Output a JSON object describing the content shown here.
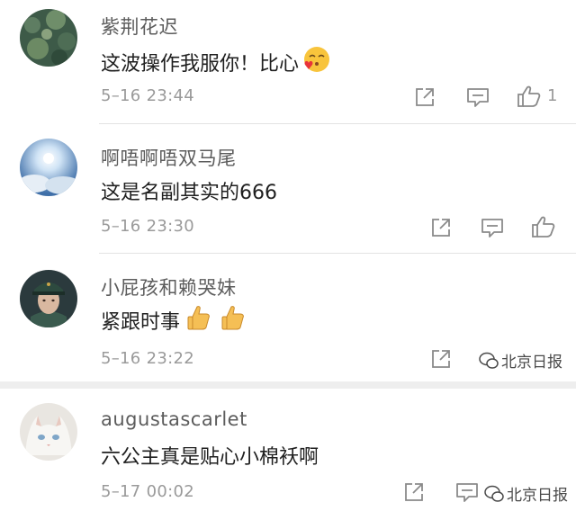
{
  "comments": [
    {
      "username": "紫荆花迟",
      "text": "这波操作我服你！比心",
      "time": "5–16 23:44",
      "likes": "1",
      "emoji": "kiss-heart-emoji-icon"
    },
    {
      "username": "啊唔啊唔双马尾",
      "text": "这是名副其实的666",
      "time": "5–16 23:30"
    },
    {
      "username": "小屁孩和赖哭妹",
      "text": "紧跟时事",
      "time": "5–16 23:22",
      "emoji": "thumbs-up-emoji-icon"
    },
    {
      "username": "augustascarlet",
      "text": "六公主真是贴心小棉袄啊",
      "time": "5–17 00:02"
    }
  ],
  "watermark": {
    "text": "北京日报"
  },
  "colors": {
    "text": "#1f1f1f",
    "username": "#5c5c5c",
    "meta": "#9a9a9a",
    "icon": "#8a8a8a",
    "divider": "#e3e3e3"
  }
}
